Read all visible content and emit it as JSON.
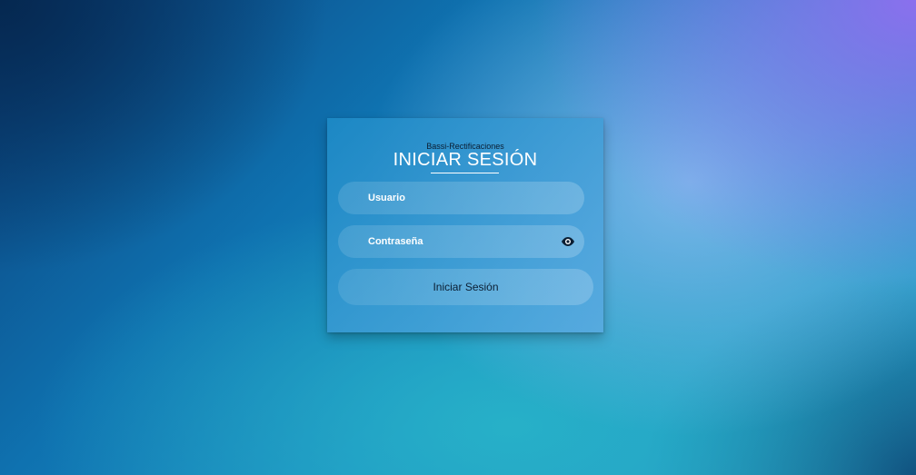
{
  "brand": "Bassi-Rectificaciones",
  "title": "INICIAR SESIÓN",
  "form": {
    "username_label": "Usuario",
    "password_label": "Contraseña",
    "password_toggle_icon": "eye-icon",
    "submit_label": "Iniciar Sesión"
  },
  "colors": {
    "title_text": "#ffffff",
    "button_text": "#0b1e33"
  }
}
